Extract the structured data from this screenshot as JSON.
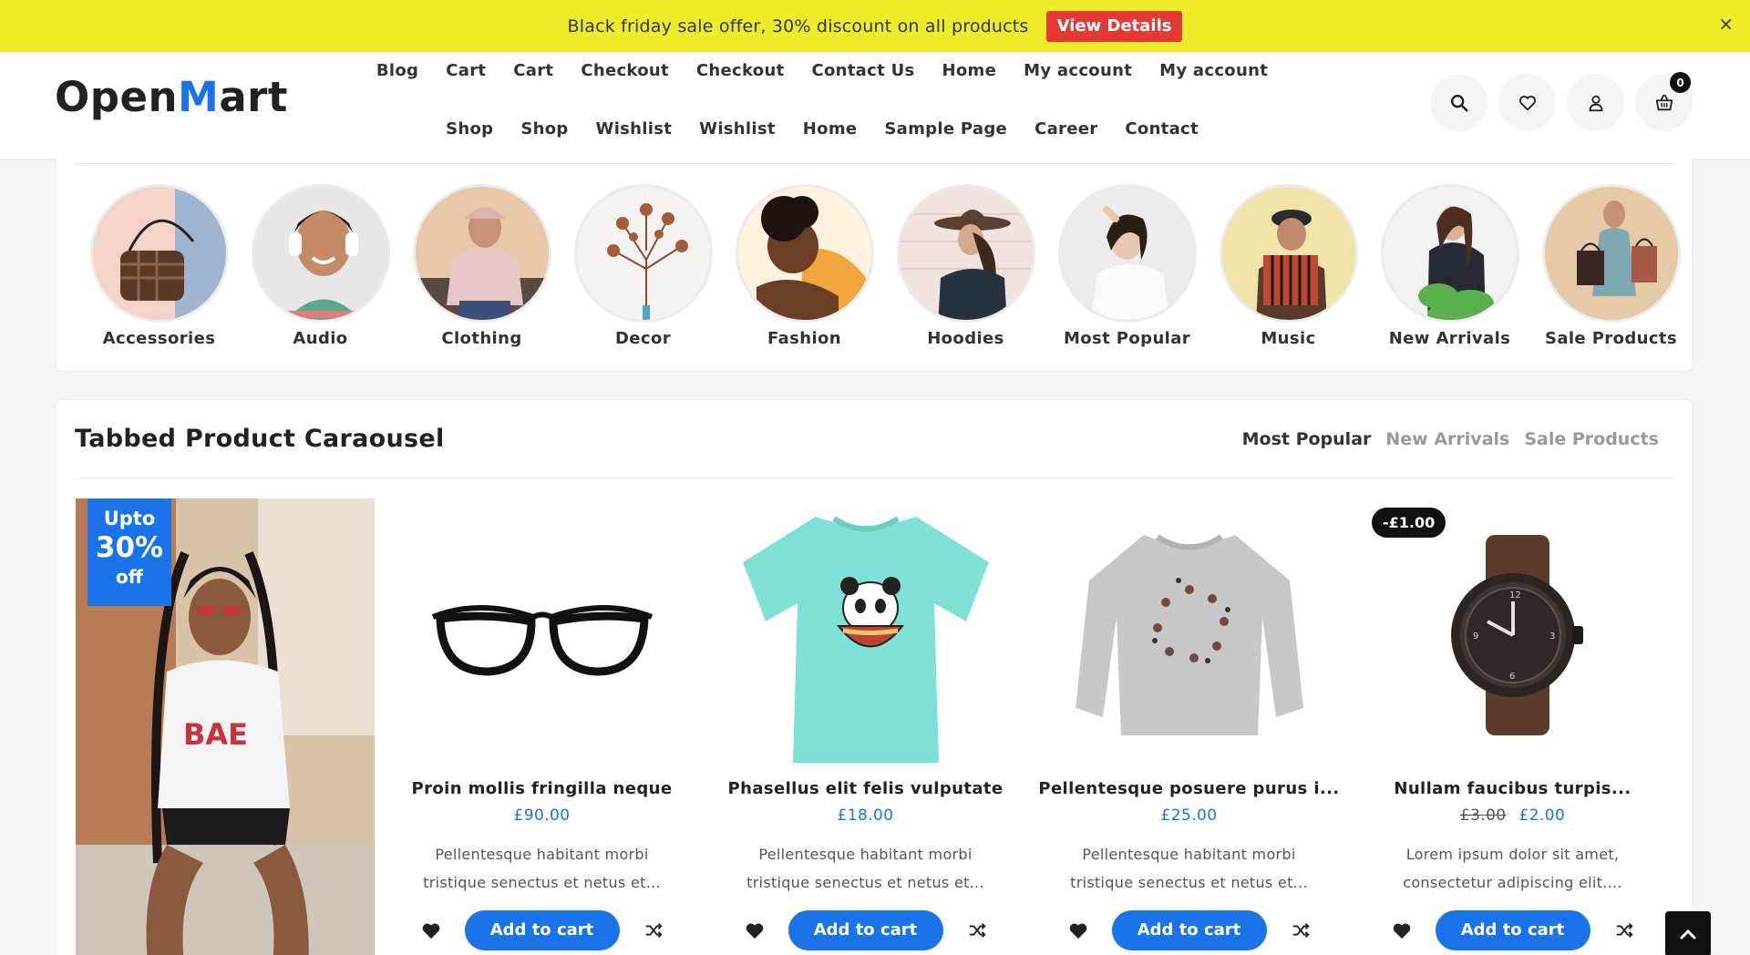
{
  "offer": {
    "text": "Black friday sale offer, 30% discount on all products",
    "button": "View Details",
    "close": "×"
  },
  "header": {
    "logo_part1": "Open",
    "logo_part2": "M",
    "logo_part3": "art",
    "nav_row1": [
      "Blog",
      "Cart",
      "Cart",
      "Checkout",
      "Checkout",
      "Contact Us",
      "Home",
      "My account",
      "My account"
    ],
    "nav_row2": [
      "Shop",
      "Shop",
      "Wishlist",
      "Wishlist",
      "Home",
      "Sample Page",
      "Career",
      "Contact"
    ],
    "icons": [
      "search-icon",
      "heart-icon",
      "user-icon",
      "basket-icon"
    ],
    "cart_count": "0"
  },
  "categories": [
    {
      "label": "Accessories",
      "icon": "handbag"
    },
    {
      "label": "Audio",
      "icon": "headphones-person"
    },
    {
      "label": "Clothing",
      "icon": "hoodie-person"
    },
    {
      "label": "Decor",
      "icon": "dried-flowers"
    },
    {
      "label": "Fashion",
      "icon": "person-yellow-shirt"
    },
    {
      "label": "Hoodies",
      "icon": "person-hat"
    },
    {
      "label": "Most Popular",
      "icon": "person-white-shirt"
    },
    {
      "label": "Music",
      "icon": "accordion-player"
    },
    {
      "label": "New Arrivals",
      "icon": "person-plants"
    },
    {
      "label": "Sale Products",
      "icon": "shopping-bags"
    }
  ],
  "product_section": {
    "title": "Tabbed Product Caraousel",
    "tabs": [
      "Most Popular",
      "New Arrivals",
      "Sale Products"
    ],
    "active_tab": "Most Popular",
    "banner": {
      "line1": "Upto",
      "line2": "30%",
      "line3": "off"
    },
    "products": [
      {
        "name": "Proin mollis fringilla neque",
        "price": "£90.00",
        "old_price": "",
        "desc1": "Pellentesque habitant morbi",
        "desc2": "tristique senectus et netus et...",
        "button": "Add to cart",
        "badge": "",
        "image": "glasses"
      },
      {
        "name": "Phasellus elit felis vulputate",
        "price": "£18.00",
        "old_price": "",
        "desc1": "Pellentesque habitant morbi",
        "desc2": "tristique senectus et netus et...",
        "button": "Add to cart",
        "badge": "",
        "image": "panda-tshirt"
      },
      {
        "name": "Pellentesque posuere purus i...",
        "price": "£25.00",
        "old_price": "",
        "desc1": "Pellentesque habitant morbi",
        "desc2": "tristique senectus et netus et...",
        "button": "Add to cart",
        "badge": "",
        "image": "sweatshirt"
      },
      {
        "name": "Nullam faucibus turpis...",
        "price": "£2.00",
        "old_price": "£3.00",
        "desc1": "Lorem ipsum dolor sit amet,",
        "desc2": "consectetur adipiscing elit....",
        "button": "Add to cart",
        "badge": "-£1.00",
        "image": "watch"
      }
    ]
  },
  "colors": {
    "accent": "#1a73e8",
    "offer_bar": "#eeeb29",
    "offer_button": "#e53935",
    "dark": "#111111"
  }
}
